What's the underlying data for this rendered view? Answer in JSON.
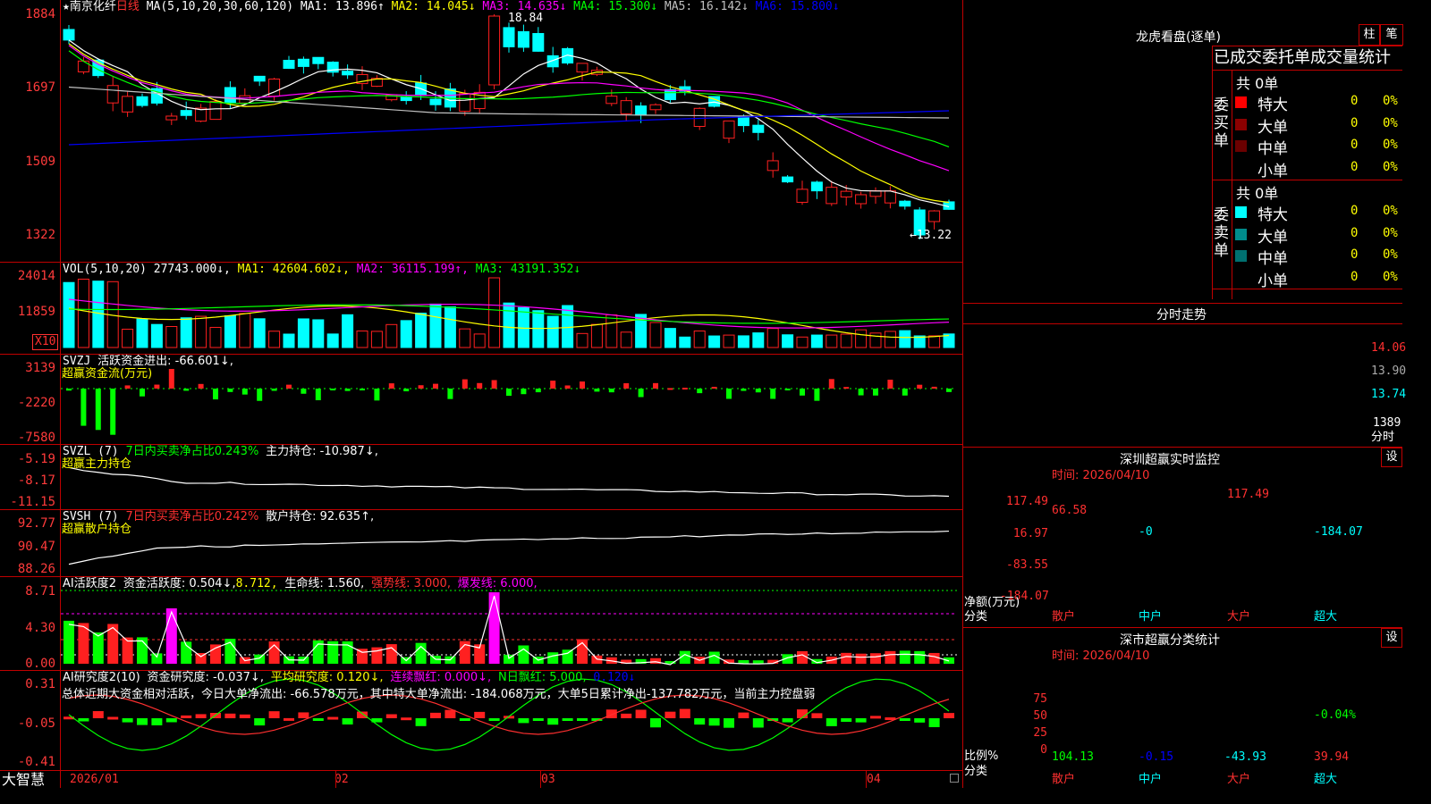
{
  "main_chart": {
    "star": "★",
    "stock_name": "南京化纤",
    "period": "日线",
    "ma_params": "MA(5,10,20,30,60,120)",
    "ma_items": [
      {
        "label": "MA1: 13.896↑",
        "color": "#ffffff"
      },
      {
        "label": "MA2: 14.045↓",
        "color": "#ffff00"
      },
      {
        "label": "MA3: 14.635↓",
        "color": "#ff00ff"
      },
      {
        "label": "MA4: 15.300↓",
        "color": "#00ff00"
      },
      {
        "label": "MA5: 16.142↓",
        "color": "#c0c0c0"
      },
      {
        "label": "MA6: 15.800↓",
        "color": "#0000ff"
      }
    ],
    "y_labels": [
      "1884",
      "1697",
      "1509",
      "1322"
    ],
    "high_mark": "18.84",
    "low_mark": "←13.22"
  },
  "vol_panel": {
    "title": "VOL(5,10,20)",
    "value": "27743.000↓,",
    "ma_items": [
      {
        "label": "MA1: 42604.602↓,",
        "color": "#ffff00"
      },
      {
        "label": "MA2: 36115.199↑,",
        "color": "#ff00ff"
      },
      {
        "label": "MA3: 43191.352↓",
        "color": "#00ff00"
      }
    ],
    "y_labels": [
      "24014",
      "11859"
    ],
    "unit": "X10"
  },
  "svzj_panel": {
    "title": "SVZJ",
    "line1": "活跃资金进出: -66.601↓,",
    "line2": "超赢资金流(万元)",
    "y_labels": [
      "3139",
      "-2220",
      "-7580"
    ]
  },
  "svzl_panel": {
    "title": "SVZL (7)",
    "ratio": "7日内买卖净占比0.243%",
    "main_hold": "主力持仓: -10.987↓,",
    "line2": "超赢主力持仓",
    "y_labels": [
      "-5.19",
      "-8.17",
      "-11.15"
    ]
  },
  "svsh_panel": {
    "title": "SVSH (7)",
    "ratio": "7日内买卖净占比0.242%",
    "retail_hold": "散户持仓: 92.635↑,",
    "line2": "超赢散户持仓",
    "y_labels": [
      "92.77",
      "90.47",
      "88.26"
    ]
  },
  "ai_active_panel": {
    "title": "AI活跃度2",
    "items": [
      {
        "label": "资金活跃度: 0.504↓,",
        "color": "#ffffff"
      },
      {
        "label": "8.712,",
        "color": "#ffff00"
      },
      {
        "label": "生命线: 1.560,",
        "color": "#ffffff"
      },
      {
        "label": "强势线: 3.000,",
        "color": "#ff3030"
      },
      {
        "label": "爆发线: 6.000,",
        "color": "#ff00ff"
      }
    ],
    "y_labels": [
      "8.71",
      "4.30",
      "0.00"
    ]
  },
  "ai_research_panel": {
    "title": "AI研究度2(10)",
    "items": [
      {
        "label": "资金研究度: -0.037↓,",
        "color": "#ffffff"
      },
      {
        "label": "平均研究度: 0.120↓,",
        "color": "#ffff00"
      },
      {
        "label": "连续飘红: 0.000↓,",
        "color": "#ff00ff"
      },
      {
        "label": "N日飘红: 5.000,",
        "color": "#00ff00"
      },
      {
        "label": "0.120↓",
        "color": "#0000ff"
      }
    ],
    "summary": "总体近期大资金相对活跃，今日大单净流出: -66.578万元，其中特大单净流出: -184.068万元，大单5日累计净出-137.782万元，当前主力控盘弱",
    "y_labels": [
      "0.31",
      "-0.05",
      "-0.41"
    ]
  },
  "x_axis": {
    "brand": "大智慧",
    "labels": [
      "2026/01",
      "02",
      "03",
      "04"
    ]
  },
  "right_panel": {
    "title": "龙虎看盘(逐单)",
    "btn_bar": "柱",
    "btn_pen": "笔",
    "header": "已成交委托单成交量统计",
    "buy": {
      "side_label": "委买单",
      "total": "共 0单",
      "rows": [
        {
          "name": "特大",
          "value": "0",
          "pct": "0%",
          "color": "#ff0000"
        },
        {
          "name": "大单",
          "value": "0",
          "pct": "0%",
          "color": "#8b0000"
        },
        {
          "name": "中单",
          "value": "0",
          "pct": "0%",
          "color": "#6b0000"
        },
        {
          "name": "小单",
          "value": "0",
          "pct": "0%",
          "color": "#000000"
        }
      ]
    },
    "sell": {
      "side_label": "委卖单",
      "total": "共 0单",
      "rows": [
        {
          "name": "特大",
          "value": "0",
          "pct": "0%",
          "color": "#00ffff"
        },
        {
          "name": "大单",
          "value": "0",
          "pct": "0%",
          "color": "#008b8b"
        },
        {
          "name": "中单",
          "value": "0",
          "pct": "0%",
          "color": "#007070"
        },
        {
          "name": "小单",
          "value": "0",
          "pct": "0%",
          "color": "#000000"
        }
      ]
    },
    "intraday": {
      "title": "分时走势",
      "y_labels": [
        "14.06",
        "13.90",
        "13.74"
      ],
      "vol_label": "1389",
      "bottom_label": "分时"
    },
    "sz_monitor": {
      "title": "深圳超赢实时监控",
      "settings": "设",
      "time": "时间: 2026/04/10",
      "y_labels": [
        "117.49",
        "16.97",
        "-83.55",
        "-184.07"
      ],
      "axis_label": "净额(万元)",
      "axis_label2": "分类",
      "categories": [
        "散户",
        "中户",
        "大户",
        "超大"
      ],
      "values": [
        66.58,
        -0.0,
        117.49,
        -184.07
      ],
      "value_labels": [
        "66.58",
        "-0",
        "117.49",
        "-184.07"
      ]
    },
    "sz_class": {
      "title": "深市超赢分类统计",
      "settings": "设",
      "time": "时间: 2026/04/10",
      "y_labels": [
        "75",
        "50",
        "25",
        "0"
      ],
      "axis_label": "比例%",
      "axis_label2": "分类",
      "categories": [
        "散户",
        "中户",
        "大户",
        "超大"
      ],
      "values": [
        104.13,
        -0.15,
        -43.93,
        39.94
      ],
      "value_labels": [
        "104.13",
        "-0.15",
        "-43.93",
        "39.94"
      ],
      "overlay_label": "-0.04%"
    }
  }
}
